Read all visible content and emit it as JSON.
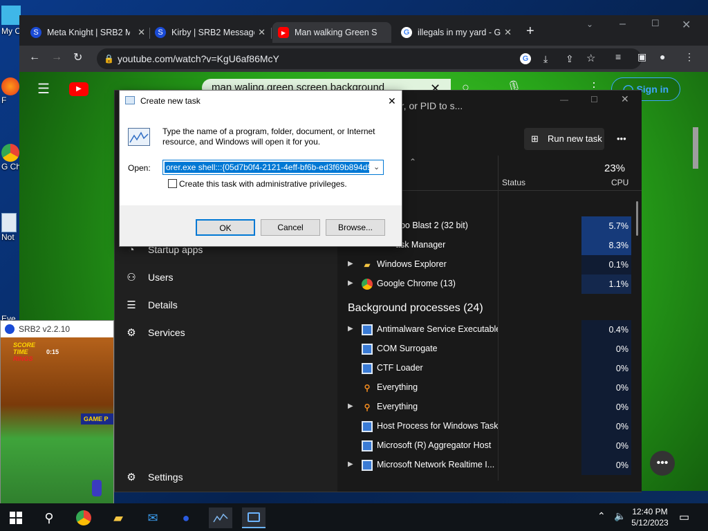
{
  "desktop": {
    "icons": [
      {
        "label": "My C",
        "name": "this-pc"
      },
      {
        "label": "F",
        "name": "firefox"
      },
      {
        "label": "G Ch",
        "name": "google-chrome"
      },
      {
        "label": "Not",
        "name": "notepad"
      },
      {
        "label": "Eve",
        "name": "everything"
      }
    ]
  },
  "browser": {
    "tabs": [
      {
        "title": "Meta Knight | SRB2 M",
        "icon": "sonic-icon",
        "active": false
      },
      {
        "title": "Kirby | SRB2 Message",
        "icon": "sonic-icon",
        "active": false
      },
      {
        "title": "Man walking Green S",
        "icon": "youtube-icon",
        "active": true
      },
      {
        "title": "illegals in my yard - G",
        "icon": "google-icon",
        "active": false
      }
    ],
    "new_tab": "+",
    "url": "youtube.com/watch?v=KgU6af86McY",
    "youtube": {
      "search_query": "man waling green screen background",
      "signin_label": "Sign in"
    }
  },
  "task_manager": {
    "search_placeholder": "er, or PID to s...",
    "run_new_task_label": "Run new task",
    "more_label": "•••",
    "columns": {
      "status": "Status",
      "cpu_total": "23%",
      "cpu": "CPU"
    },
    "nav": [
      {
        "label": "Startup apps",
        "icon": "startup-icon"
      },
      {
        "label": "Users",
        "icon": "users-icon"
      },
      {
        "label": "Details",
        "icon": "details-icon"
      },
      {
        "label": "Services",
        "icon": "services-icon"
      },
      {
        "label": "Settings",
        "icon": "settings-icon"
      }
    ],
    "apps": [
      {
        "name": "obo Blast 2 (32 bit)",
        "cpu": "5.7%",
        "expandable": false,
        "icon": "srb2-icon"
      },
      {
        "name": "ask Manager",
        "cpu": "8.3%",
        "expandable": false,
        "icon": "task-manager-icon"
      },
      {
        "name": "Windows Explorer",
        "cpu": "0.1%",
        "expandable": true,
        "icon": "folder-icon"
      },
      {
        "name": "Google Chrome (13)",
        "cpu": "1.1%",
        "expandable": true,
        "icon": "chrome-icon"
      }
    ],
    "background_header": "Background processes (24)",
    "background": [
      {
        "name": "Antimalware Service Executable",
        "cpu": "0.4%",
        "expandable": true,
        "icon": "process-icon"
      },
      {
        "name": "COM Surrogate",
        "cpu": "0%",
        "expandable": false,
        "icon": "process-icon"
      },
      {
        "name": "CTF Loader",
        "cpu": "0%",
        "expandable": false,
        "icon": "process-icon"
      },
      {
        "name": "Everything",
        "cpu": "0%",
        "expandable": false,
        "icon": "search-magnifier-icon"
      },
      {
        "name": "Everything",
        "cpu": "0%",
        "expandable": true,
        "icon": "search-magnifier-icon"
      },
      {
        "name": "Host Process for Windows Tasks",
        "cpu": "0%",
        "expandable": false,
        "icon": "process-icon"
      },
      {
        "name": "Microsoft (R) Aggregator Host",
        "cpu": "0%",
        "expandable": false,
        "icon": "process-icon"
      },
      {
        "name": "Microsoft Network Realtime I...",
        "cpu": "0%",
        "expandable": true,
        "icon": "process-icon"
      }
    ]
  },
  "run_dialog": {
    "title": "Create new task",
    "description": "Type the name of a program, folder, document, or Internet resource, and Windows will open it for you.",
    "open_label": "Open:",
    "open_value": "orer.exe shell:::{05d7b0f4-2121-4eff-bf6b-ed3f69b894d9}",
    "admin_label": "Create this task with administrative privileges.",
    "admin_checked": false,
    "ok_label": "OK",
    "cancel_label": "Cancel",
    "browse_label": "Browse..."
  },
  "srb2": {
    "title": "SRB2 v2.2.10",
    "hud1": [
      "SCORE",
      "TIME",
      "RINGS"
    ],
    "time1": "0:15",
    "banner": "GAME P"
  },
  "taskbar": {
    "time": "12:40 PM",
    "date": "5/12/2023",
    "apps": [
      "start-icon",
      "search-icon",
      "chrome-icon",
      "file-explorer-icon",
      "mail-icon",
      "srb2-icon",
      "task-manager-icon",
      "run-icon"
    ]
  },
  "colors": {
    "accent": "#0078d4",
    "cpu_high": "#163a7a",
    "youtube_red": "#ff0000"
  }
}
